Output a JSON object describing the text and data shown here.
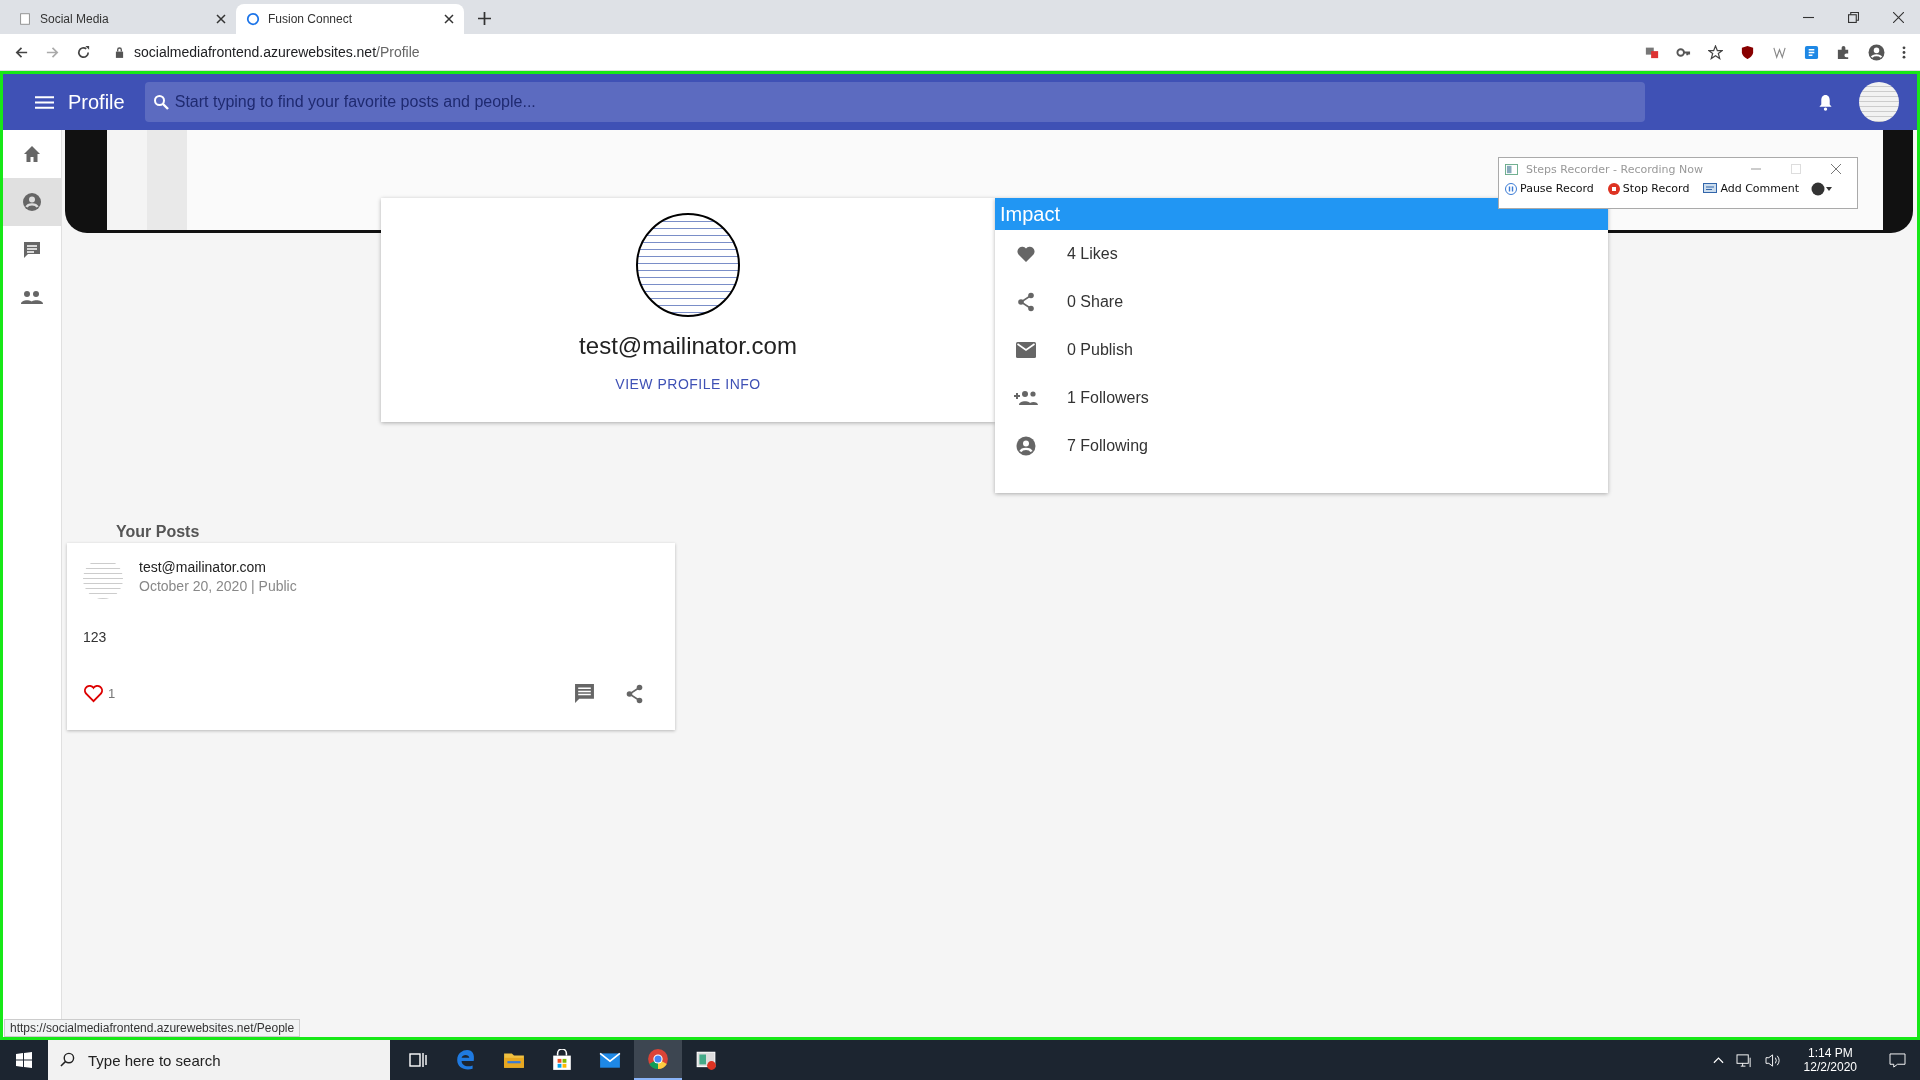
{
  "browser": {
    "tabs": [
      {
        "title": "Social Media",
        "selected": false
      },
      {
        "title": "Fusion Connect",
        "selected": true
      }
    ],
    "url_host": "socialmediafrontend.azurewebsites.net",
    "url_path": "/Profile"
  },
  "app_bar": {
    "title": "Profile",
    "search": {
      "placeholder": "Start typing to find your favorite posts and people..."
    }
  },
  "sidebar": {
    "items": [
      {
        "kind": "home",
        "selected": false
      },
      {
        "kind": "profile",
        "selected": true
      },
      {
        "kind": "messages",
        "selected": false
      },
      {
        "kind": "people",
        "selected": false
      }
    ]
  },
  "profile_card": {
    "email": "test@mailinator.com",
    "link": "VIEW PROFILE INFO"
  },
  "impact": {
    "title": "Impact",
    "stats": [
      {
        "kind": "likes",
        "label": "4 Likes"
      },
      {
        "kind": "share",
        "label": "0 Share"
      },
      {
        "kind": "publish",
        "label": "0 Publish"
      },
      {
        "kind": "followers",
        "label": "1 Followers"
      },
      {
        "kind": "following",
        "label": "7 Following"
      }
    ]
  },
  "posts_heading": "Your Posts",
  "posts": [
    {
      "author": "test@mailinator.com",
      "meta": "October 20, 2020 | Public",
      "body": "123",
      "likes": "1",
      "liked": true
    }
  ],
  "steps_recorder": {
    "title": "Steps Recorder - Recording Now",
    "buttons": [
      {
        "kind": "pause",
        "label": "Pause Record"
      },
      {
        "kind": "stop",
        "label": "Stop Record"
      },
      {
        "kind": "comment",
        "label": "Add Comment"
      }
    ]
  },
  "status_url": "https://socialmediafrontend.azurewebsites.net/People",
  "taskbar": {
    "search_placeholder": "Type here to search",
    "apps": [
      {
        "kind": "taskview",
        "selected": false
      },
      {
        "kind": "edge",
        "selected": false
      },
      {
        "kind": "explorer",
        "selected": false
      },
      {
        "kind": "store",
        "selected": false
      },
      {
        "kind": "mail",
        "selected": false
      },
      {
        "kind": "chrome",
        "selected": true
      },
      {
        "kind": "recorder",
        "selected": false
      }
    ],
    "time": "1:14 PM",
    "date": "12/2/2020"
  }
}
